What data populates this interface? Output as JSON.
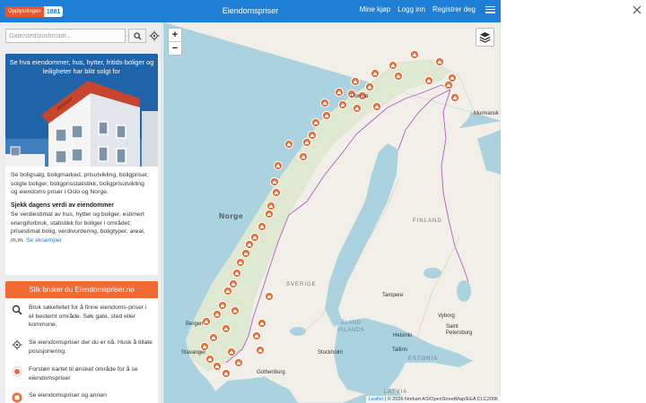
{
  "header": {
    "logo_brand": "Opplysningen",
    "logo_number": "1881",
    "title": "Eiendomspriser",
    "nav": [
      "Mine kjøp",
      "Logg inn",
      "Registrer deg"
    ]
  },
  "sidebar": {
    "search_placeholder": "Gate/sted/postnr/adr...",
    "hero_text": "Se hva eiendommer, hus, hytter, fritids-boliger og leiligheter har blitt solgt for",
    "info_p1": "Se boligsalg, boligmarked, prisutvikling, boligpriser, solgte boliger, boligprisstatistikk, boligprisutvikling og eiendoms priser i Oslo og Norge.",
    "info_h": "Sjekk dagens verdi av eiendommer",
    "info_p2": "Se verdiestimat av hus, hytter og boliger, estimert energiforbruk, statistikk for boliger i området; prisestimat bolig, verdivurdering, boligtyper, areal, m.m.",
    "info_link": "Se eksempel",
    "howto_title": "Slik bruker du Eiendomspriser.no",
    "howto_items": [
      {
        "icon": "search-icon",
        "text": "Bruk søkefeltet for å finne eiendoms-priser i et bestemt område. Søk gate, sted eller kommune."
      },
      {
        "icon": "crosshair-icon",
        "text": "Se eiendomspriser der du er nå. Husk å tillate posisjonering."
      },
      {
        "icon": "map-marker-icon",
        "text": "Forstørr kartet til ønsket område for å se eiendomspriser"
      },
      {
        "icon": "orange-marker-icon",
        "text": "Se eiendomspriser og annen"
      }
    ]
  },
  "map": {
    "zoom_in": "+",
    "zoom_out": "−",
    "countries": [
      "Norge",
      "FINLAND",
      "SVERIGE",
      "ESTONIA",
      "LATVIA"
    ],
    "regions": [
      "ÅLAND",
      "ISLANDS"
    ],
    "cities": [
      "Murmansk",
      "Tampere",
      "Helsinki",
      "Saint Petersburg",
      "Tallinn",
      "Stockholm",
      "Gothenburg",
      "Bergen",
      "Stavanger",
      "Tromsø",
      "Vyborg"
    ],
    "attribution_link": "Leaflet",
    "attribution_text": "| © 2026 Norkart AS/OpenStreetMap/EEA CLC2006"
  },
  "colors": {
    "header_blue": "#1f7fd6",
    "accent_orange": "#f06a32",
    "hero_blue": "#1f63a8",
    "water": "#aad3df",
    "land": "#f2efe9",
    "border_purple": "#b05cc4"
  }
}
